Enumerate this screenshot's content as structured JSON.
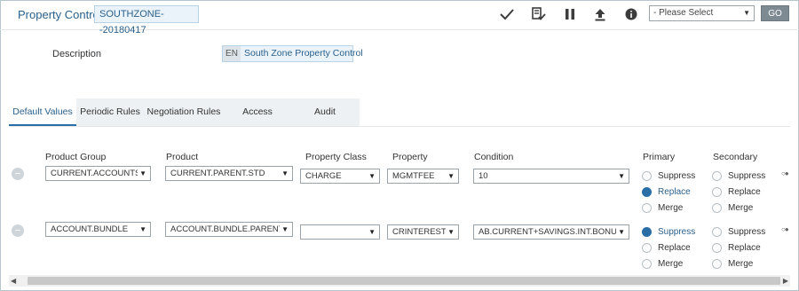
{
  "header": {
    "title": "Property Control",
    "record_id": "SOUTHZONE--20180417",
    "toolbar_icons": [
      "check-icon",
      "edit-validate-icon",
      "pause-icon",
      "upload-icon",
      "info-icon"
    ],
    "select": {
      "value": "- Please Select"
    },
    "go_label": "GO"
  },
  "description": {
    "label": "Description",
    "required_marker": "•",
    "lang": "EN",
    "value": "South Zone Property Control"
  },
  "tabs": [
    {
      "label": "Default Values",
      "active": true
    },
    {
      "label": "Periodic Rules",
      "active": false
    },
    {
      "label": "Negotiation Rules",
      "active": false
    },
    {
      "label": "Access",
      "active": false
    },
    {
      "label": "Audit",
      "active": false
    }
  ],
  "grid": {
    "headers": {
      "product_group": "Product Group",
      "product": "Product",
      "property_class": "Property Class",
      "property": "Property",
      "condition": "Condition",
      "primary": "Primary",
      "secondary": "Secondary"
    },
    "radio_options": [
      "Suppress",
      "Replace",
      "Merge"
    ],
    "rows": [
      {
        "product_group": "CURRENT.ACCOUNTS",
        "product": "CURRENT.PARENT.STD",
        "property_class": "CHARGE",
        "property": "MGMTFEE",
        "condition": "10",
        "primary_selected": "Replace",
        "secondary_selected": ""
      },
      {
        "product_group": "ACCOUNT.BUNDLE",
        "product": "ACCOUNT.BUNDLE.PARENT",
        "property_class": "",
        "property": "CRINTEREST",
        "condition": "AB.CURRENT+SAVINGS.INT.BONUS",
        "primary_selected": "Suppress",
        "secondary_selected": ""
      }
    ],
    "remove_icon": "minus-circle-icon",
    "row_control_icon": "row-toggle-icon"
  },
  "colors": {
    "accent": "#2a6ea8",
    "title_blue": "#2a5f8a",
    "go_button": "#7d8a92"
  }
}
